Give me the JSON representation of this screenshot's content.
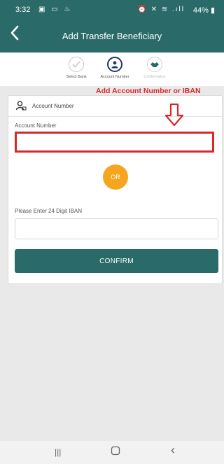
{
  "status_bar": {
    "time": "3:32",
    "left_icons": "▣ ▭ ♨",
    "right_icons": "⏰ ✕ ≋ .ıll",
    "battery": "44%"
  },
  "app_bar": {
    "title": "Add Transfer Beneficiary",
    "back_icon": "back-arrow-icon"
  },
  "stepper": {
    "steps": [
      {
        "label": "Select Bank",
        "state": "done",
        "icon": "check-icon"
      },
      {
        "label": "Account Number",
        "state": "active",
        "icon": "account-icon"
      },
      {
        "label": "Confirmation",
        "state": "pending",
        "icon": "handshake-icon"
      }
    ]
  },
  "annotation": {
    "text": "Add Account Number or IBAN",
    "color": "#d8282b"
  },
  "card": {
    "header_label": "Account Number",
    "account_label": "Account Number",
    "account_value": "",
    "or_label": "OR",
    "iban_label": "Please Enter 24 Digit IBAN",
    "iban_value": "",
    "confirm_label": "CONFIRM"
  },
  "nav_bar": {
    "recents": "|||",
    "home": "○",
    "back": "‹"
  },
  "colors": {
    "primary": "#2a6b6a",
    "accent": "#f6a51e",
    "highlight": "#d8282b"
  }
}
